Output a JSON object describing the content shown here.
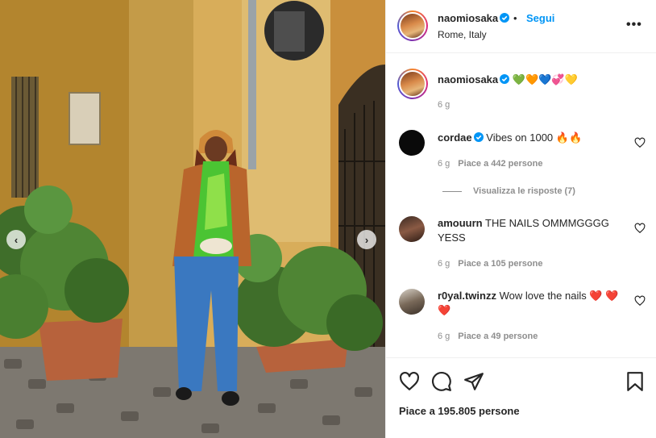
{
  "post": {
    "username": "naomiosaka",
    "follow_label": "Segui",
    "separator": "•",
    "location": "Rome, Italy",
    "more_label": "•••",
    "caption_emojis": "💚🧡💙💞💛",
    "caption_time": "6 g"
  },
  "comments": [
    {
      "username": "cordae",
      "verified": true,
      "text": "Vibes on 1000 🔥🔥",
      "time": "6 g",
      "likes": "Piace a 442 persone",
      "replies": "Visualizza le risposte (7)"
    },
    {
      "username": "amouurn",
      "verified": false,
      "text": "THE NAILS OMMMGGGG YESS",
      "time": "6 g",
      "likes": "Piace a 105 persone"
    },
    {
      "username": "r0yal.twinzz",
      "verified": false,
      "text": "Wow love the nails ❤️ ❤️❤️",
      "time": "6 g",
      "likes": "Piace a 49 persone"
    }
  ],
  "footer": {
    "likes_total": "Piace a 195.805 persone"
  },
  "colors": {
    "link_blue": "#0095f6",
    "verified_blue": "#0095f6",
    "muted": "#8e8e8e"
  },
  "icons": {
    "like": "heart-icon",
    "comment": "comment-icon",
    "share": "paper-plane-icon",
    "save": "bookmark-icon",
    "prev": "chevron-left-icon",
    "next": "chevron-right-icon"
  }
}
